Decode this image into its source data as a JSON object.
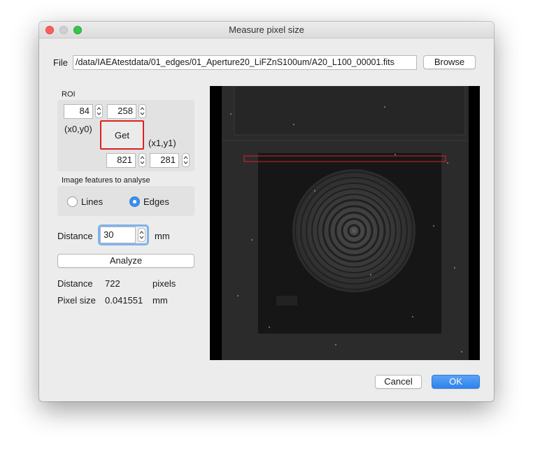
{
  "window": {
    "title": "Measure pixel size"
  },
  "file": {
    "label": "File",
    "path": "/data/IAEAtestdata/01_edges/01_Aperture20_LiFZnS100um/A20_L100_00001.fits",
    "browse_label": "Browse"
  },
  "roi": {
    "label": "ROI",
    "x0": "84",
    "y0": "258",
    "x1": "821",
    "y1": "281",
    "p0_label": "(x0,y0)",
    "p1_label": "(x1,y1)",
    "get_label": "Get"
  },
  "features": {
    "label": "Image features to analyse",
    "lines_label": "Lines",
    "edges_label": "Edges",
    "selected": "Edges"
  },
  "distance_input": {
    "label": "Distance",
    "value": "30",
    "unit": "mm"
  },
  "analyze_label": "Analyze",
  "results": {
    "distance_label": "Distance",
    "distance_value": "722",
    "distance_unit": "pixels",
    "pixel_size_label": "Pixel size",
    "pixel_size_value": "0.041551",
    "pixel_size_unit": "mm"
  },
  "footer": {
    "cancel_label": "Cancel",
    "ok_label": "OK"
  },
  "colors": {
    "accent": "#3b8ff0",
    "roi_highlight": "#e02020",
    "ok_button": "#3b8ff0"
  },
  "icons": [
    "close-window-icon",
    "minimize-window-icon",
    "maximize-window-icon",
    "spinner-arrows-icon",
    "radio-icon"
  ]
}
